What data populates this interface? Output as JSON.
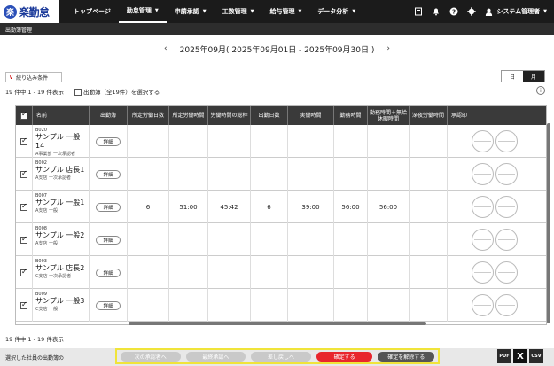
{
  "app": {
    "logo_mark": "楽",
    "logo_text": "楽勤怠"
  },
  "nav": [
    {
      "label": "トップページ",
      "caret": false,
      "active": false
    },
    {
      "label": "勤怠管理",
      "caret": true,
      "active": true
    },
    {
      "label": "申請承認",
      "caret": true,
      "active": false
    },
    {
      "label": "工数管理",
      "caret": true,
      "active": false
    },
    {
      "label": "給与管理",
      "caret": true,
      "active": false
    },
    {
      "label": "データ分析",
      "caret": true,
      "active": false
    }
  ],
  "header_right": {
    "user_label": "システム管理者"
  },
  "subbar": {
    "title": "出勤簿管理"
  },
  "period": {
    "label": "2025年09月( 2025年09月01日 - 2025年09月30日 )",
    "prev": "‹",
    "next": "›"
  },
  "filter": {
    "label": "絞り込み条件",
    "chevron": "∨"
  },
  "view_toggle": {
    "day": "日",
    "month": "月",
    "selected": "月"
  },
  "counts": {
    "top": "19 件中 1 - 19 件表示",
    "select_all_label": "出勤簿（全19件）を選択する",
    "bottom": "19 件中 1 - 19 件表示"
  },
  "table": {
    "headers": [
      "名前",
      "出勤簿",
      "所定労働日数",
      "所定労働時間",
      "労働時間の総枠",
      "出勤日数",
      "実働時間",
      "勤務時間",
      "勤務時間＋無給休暇時間",
      "深夜労働時間",
      "承認印"
    ],
    "detail_label": "詳細",
    "rows": [
      {
        "code": "B020",
        "name": "サンプル 一般14",
        "sub": "A事業部 一次承認者",
        "checked": true,
        "values": [
          "",
          "",
          "",
          "",
          "",
          "",
          "",
          ""
        ]
      },
      {
        "code": "B002",
        "name": "サンプル 店長1",
        "sub": "A支店 一次承認者",
        "checked": true,
        "values": [
          "",
          "",
          "",
          "",
          "",
          "",
          "",
          ""
        ]
      },
      {
        "code": "B007",
        "name": "サンプル 一般1",
        "sub": "A支店 一般",
        "checked": true,
        "values": [
          "6",
          "51:00",
          "45:42",
          "6",
          "39:00",
          "56:00",
          "56:00",
          ""
        ]
      },
      {
        "code": "B008",
        "name": "サンプル 一般2",
        "sub": "A支店 一般",
        "checked": true,
        "values": [
          "",
          "",
          "",
          "",
          "",
          "",
          "",
          ""
        ]
      },
      {
        "code": "B003",
        "name": "サンプル 店長2",
        "sub": "C支店 一次承認者",
        "checked": true,
        "values": [
          "",
          "",
          "",
          "",
          "",
          "",
          "",
          ""
        ]
      },
      {
        "code": "B009",
        "name": "サンプル 一般3",
        "sub": "C支店 一般",
        "checked": true,
        "values": [
          "",
          "",
          "",
          "",
          "",
          "",
          "",
          ""
        ]
      }
    ]
  },
  "bottom": {
    "label": "選択した社員の出勤簿の",
    "actions": [
      {
        "label": "次の承認者へ",
        "style": "dis"
      },
      {
        "label": "最終承認へ",
        "style": "dis"
      },
      {
        "label": "差し戻しへ",
        "style": "dis"
      },
      {
        "label": "確定する",
        "style": "red"
      },
      {
        "label": "確定を解除する",
        "style": "dark"
      }
    ],
    "exports": [
      "PDF",
      "X",
      "CSV"
    ]
  },
  "colors": {
    "accent_red": "#e8262c",
    "header_dark": "#1b1b1b",
    "highlight": "#f0e43a"
  }
}
